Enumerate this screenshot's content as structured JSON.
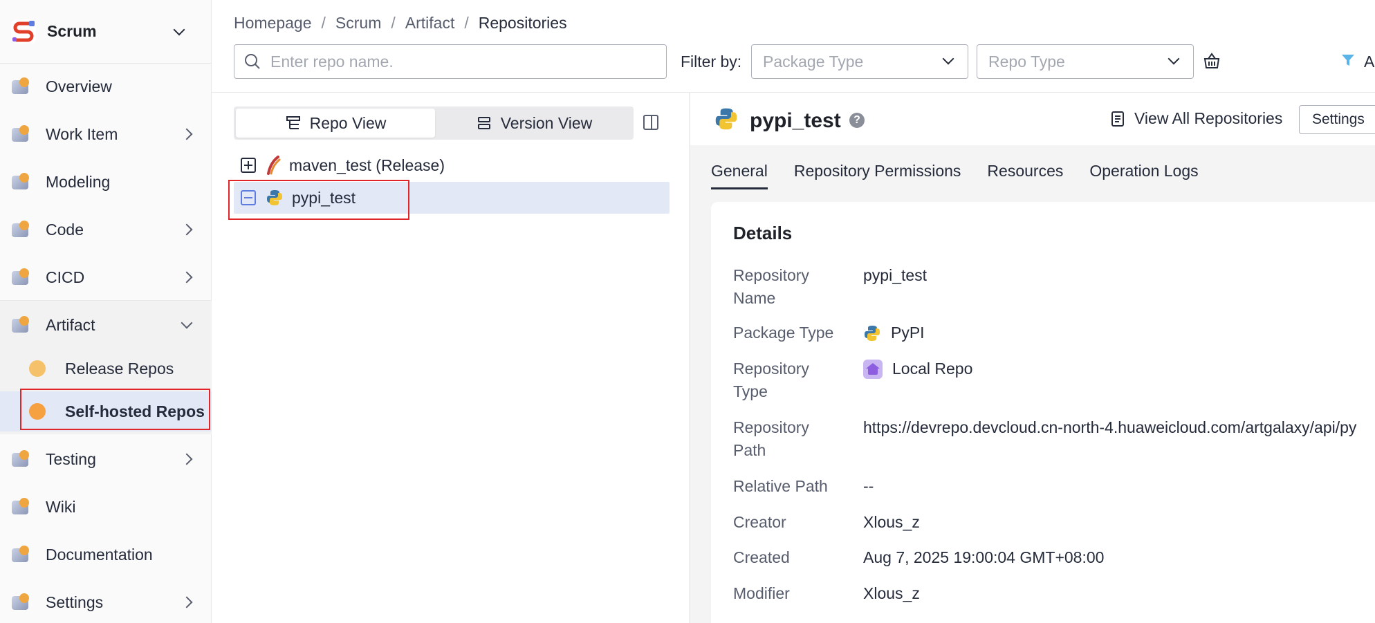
{
  "project": {
    "name": "Scrum"
  },
  "sidebar": {
    "items": [
      {
        "label": "Overview",
        "icon": "overview-icon",
        "has_children": false
      },
      {
        "label": "Work Item",
        "icon": "work-item-icon",
        "has_children": true
      },
      {
        "label": "Modeling",
        "icon": "modeling-icon",
        "has_children": false
      },
      {
        "label": "Code",
        "icon": "code-icon",
        "has_children": true
      },
      {
        "label": "CICD",
        "icon": "cicd-icon",
        "has_children": true
      },
      {
        "label": "Artifact",
        "icon": "artifact-icon",
        "has_children": true,
        "expanded": true
      },
      {
        "label": "Testing",
        "icon": "testing-icon",
        "has_children": true
      },
      {
        "label": "Wiki",
        "icon": "wiki-icon",
        "has_children": false
      },
      {
        "label": "Documentation",
        "icon": "documentation-icon",
        "has_children": false
      },
      {
        "label": "Settings",
        "icon": "settings-icon",
        "has_children": true
      }
    ],
    "artifact_children": [
      {
        "label": "Release Repos",
        "active": false
      },
      {
        "label": "Self-hosted Repos",
        "active": true
      }
    ]
  },
  "breadcrumb": [
    "Homepage",
    "Scrum",
    "Artifact",
    "Repositories"
  ],
  "toolbar": {
    "search_placeholder": "Enter repo name.",
    "filter_label": "Filter by:",
    "package_type_placeholder": "Package Type",
    "repo_type_placeholder": "Repo Type",
    "truncated_action": "A"
  },
  "tree": {
    "views": [
      "Repo View",
      "Version View"
    ],
    "active_view": "Repo View",
    "repos": [
      {
        "name": "maven_test (Release)",
        "type": "maven",
        "expanded": false,
        "selected": false
      },
      {
        "name": "pypi_test",
        "type": "pypi",
        "expanded": true,
        "selected": true
      }
    ]
  },
  "detail": {
    "title": "pypi_test",
    "view_all_label": "View All Repositories",
    "settings_label": "Settings",
    "tabs": [
      "General",
      "Repository Permissions",
      "Resources",
      "Operation Logs"
    ],
    "active_tab": "General",
    "section_title": "Details",
    "fields": {
      "name_label_1": "Repository",
      "name_label_2": "Name",
      "name_value": "pypi_test",
      "package_type_label": "Package Type",
      "package_type_value": "PyPI",
      "repo_type_label_1": "Repository",
      "repo_type_label_2": "Type",
      "repo_type_value": "Local Repo",
      "path_label_1": "Repository",
      "path_label_2": "Path",
      "path_value": "https://devrepo.devcloud.cn-north-4.huaweicloud.com/artgalaxy/api/py",
      "relative_path_label": "Relative Path",
      "relative_path_value": "--",
      "creator_label": "Creator",
      "creator_value": "Xlous_z",
      "created_label": "Created",
      "created_value": "Aug 7, 2025 19:00:04 GMT+08:00",
      "modifier_label": "Modifier",
      "modifier_value": "Xlous_z"
    }
  },
  "colors": {
    "selected_bg": "#e3e8f7",
    "highlight_box": "#e0242a",
    "accent": "#5e7ce0"
  }
}
